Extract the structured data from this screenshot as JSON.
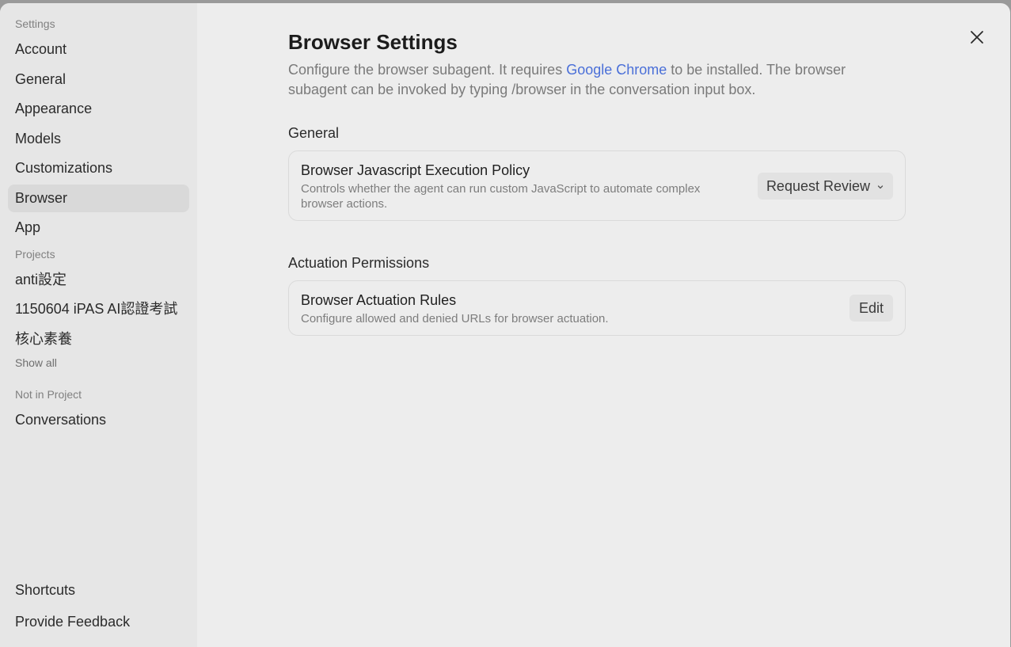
{
  "sidebar": {
    "settings_header": "Settings",
    "settings_items": [
      {
        "label": "Account"
      },
      {
        "label": "General"
      },
      {
        "label": "Appearance"
      },
      {
        "label": "Models"
      },
      {
        "label": "Customizations"
      },
      {
        "label": "Browser",
        "active": true
      },
      {
        "label": "App"
      }
    ],
    "projects_header": "Projects",
    "projects": [
      {
        "label": "anti設定"
      },
      {
        "label": "1150604 iPAS AI認證考試"
      },
      {
        "label": "核心素養"
      }
    ],
    "show_all": "Show all",
    "not_in_project_header": "Not in Project",
    "conversations": "Conversations",
    "shortcuts": "Shortcuts",
    "feedback": "Provide Feedback"
  },
  "main": {
    "title": "Browser Settings",
    "desc_before": "Configure the browser subagent. It requires ",
    "desc_link": "Google Chrome",
    "desc_after": " to be installed. The browser subagent can be invoked by typing /browser in the conversation input box.",
    "general_title": "General",
    "js_policy": {
      "title": "Browser Javascript Execution Policy",
      "desc": "Controls whether the agent can run custom JavaScript to automate complex browser actions.",
      "value": "Request Review"
    },
    "actuation_title": "Actuation Permissions",
    "actuation_rules": {
      "title": "Browser Actuation Rules",
      "desc": "Configure allowed and denied URLs for browser actuation.",
      "button": "Edit"
    }
  },
  "icons": {
    "close": "close-icon",
    "chevron": "chevron-down-icon"
  },
  "colors": {
    "link": "#4a6fd8",
    "active_bg": "#d9d9d9"
  }
}
